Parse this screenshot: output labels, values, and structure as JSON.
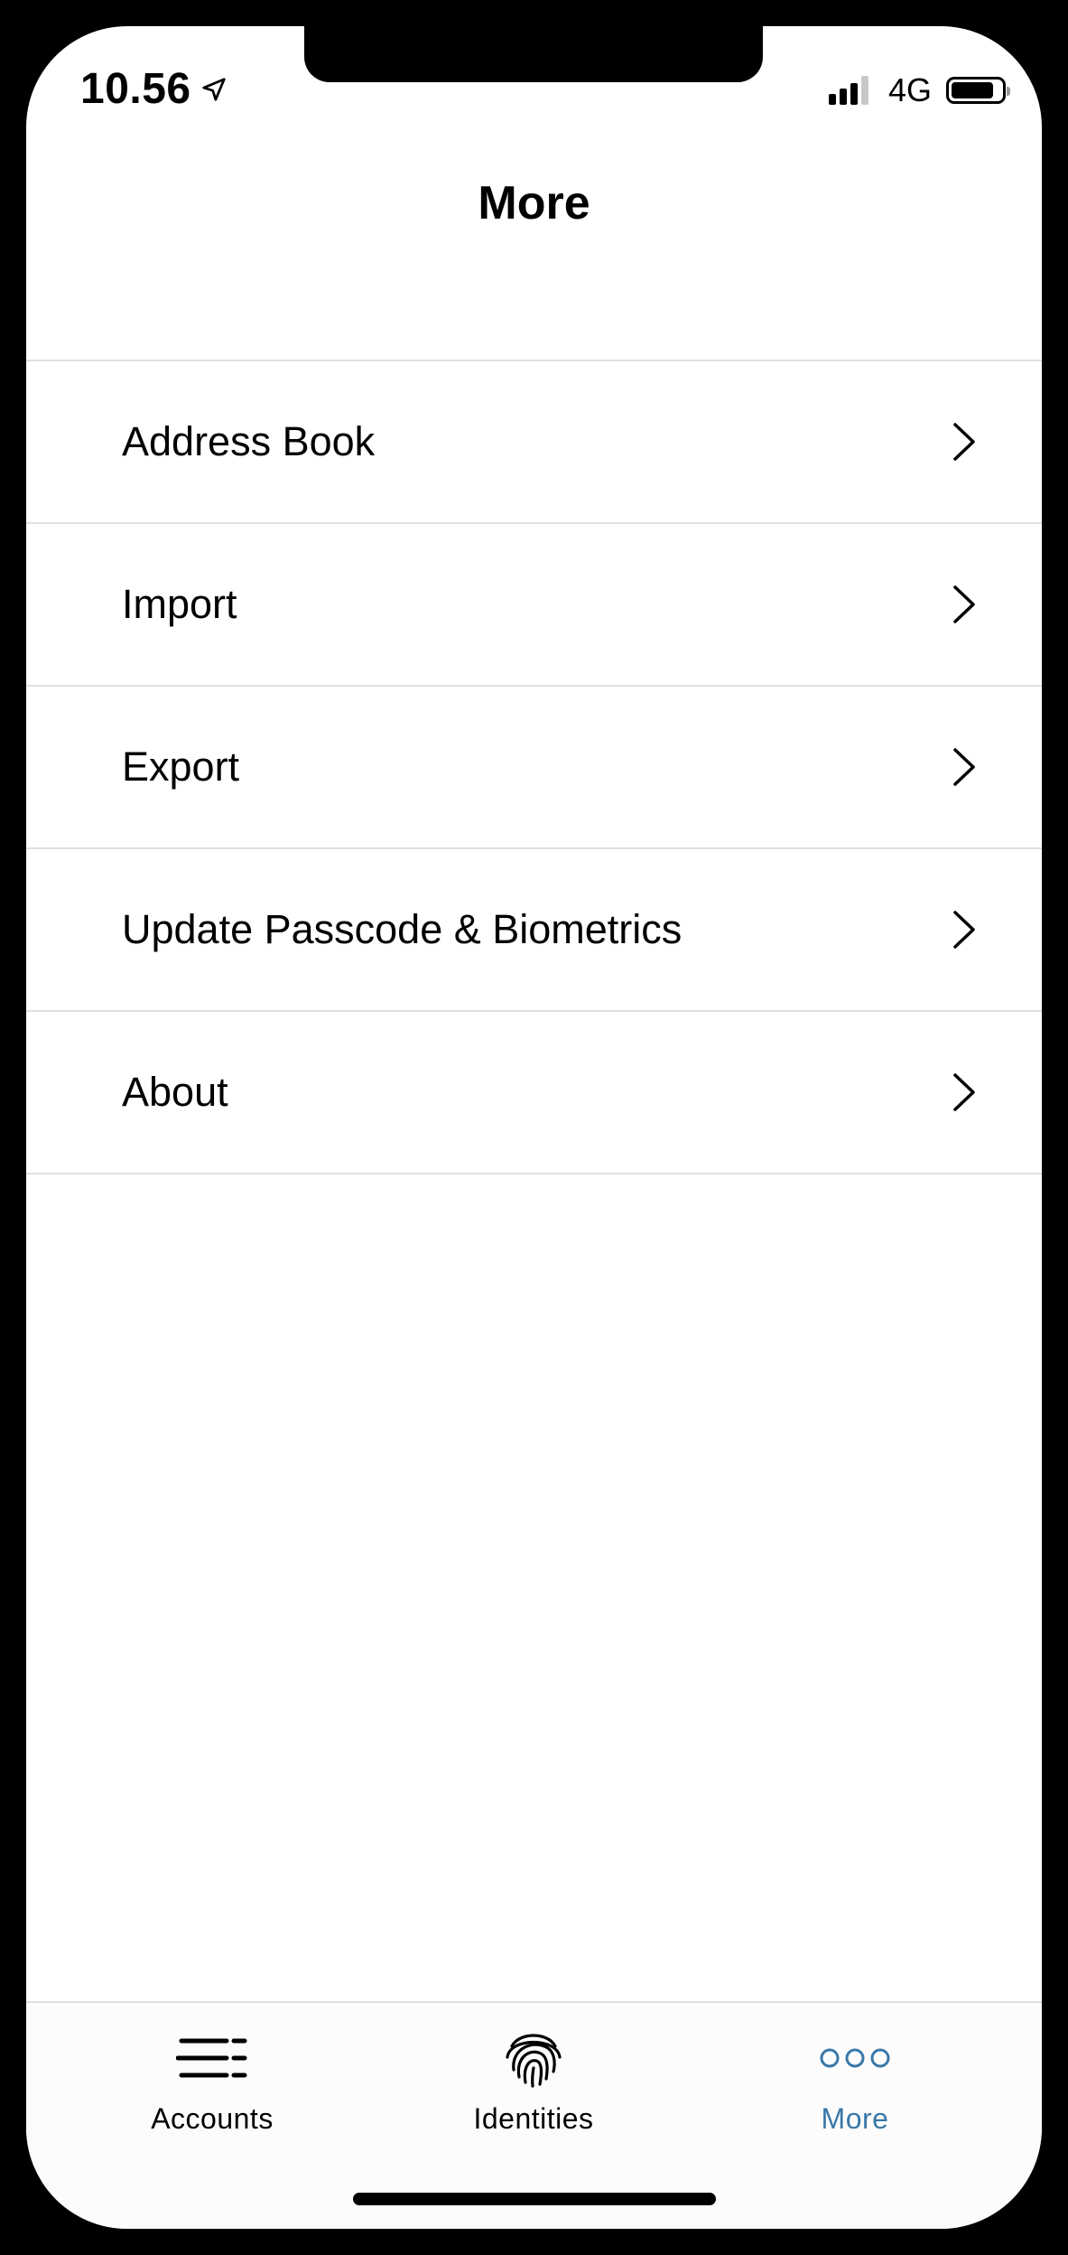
{
  "status_bar": {
    "time": "10.56",
    "network": "4G"
  },
  "header": {
    "title": "More"
  },
  "menu": {
    "items": [
      {
        "label": "Address Book"
      },
      {
        "label": "Import"
      },
      {
        "label": "Export"
      },
      {
        "label": "Update Passcode & Biometrics"
      },
      {
        "label": "About"
      }
    ]
  },
  "tabbar": {
    "tabs": [
      {
        "label": "Accounts",
        "icon": "list-icon",
        "active": false
      },
      {
        "label": "Identities",
        "icon": "fingerprint-icon",
        "active": false
      },
      {
        "label": "More",
        "icon": "more-dots-icon",
        "active": true
      }
    ]
  },
  "colors": {
    "accent": "#3a78a8",
    "separator": "#e0e0e0",
    "text": "#000000",
    "background": "#ffffff"
  }
}
